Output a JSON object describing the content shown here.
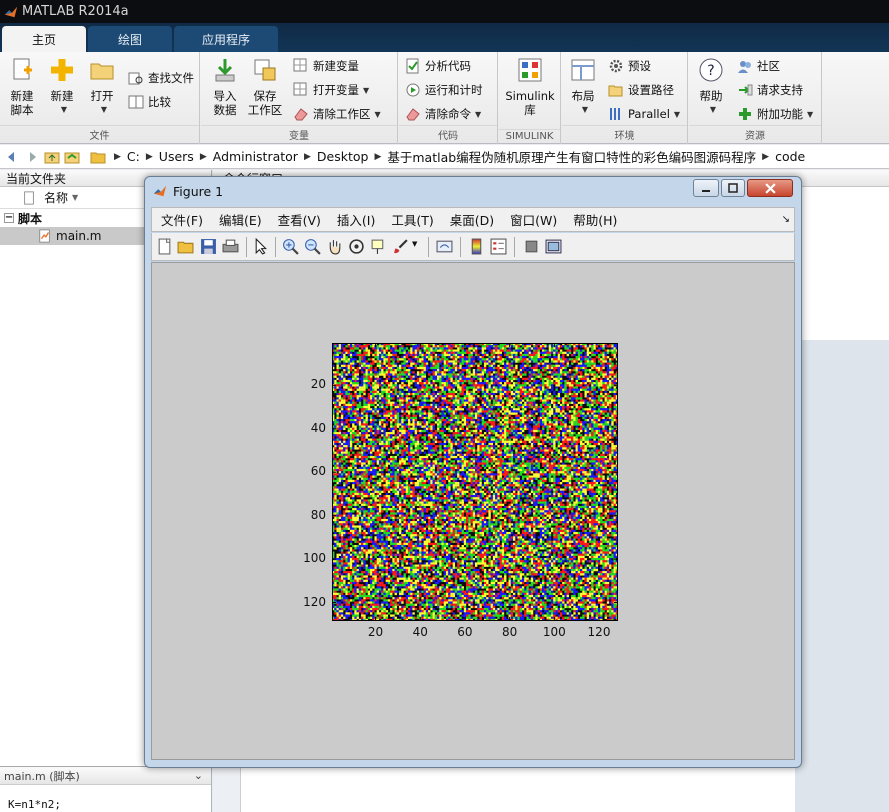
{
  "app": {
    "title": "MATLAB R2014a"
  },
  "tabs": [
    {
      "label": "主页",
      "active": true
    },
    {
      "label": "绘图",
      "active": false
    },
    {
      "label": "应用程序",
      "active": false
    }
  ],
  "ribbon": {
    "file": {
      "label": "文件",
      "new_script": "新建\n脚本",
      "new": "新建",
      "open": "打开",
      "find_files": "查找文件",
      "compare": "比较"
    },
    "variable": {
      "label": "变量",
      "import": "导入\n数据",
      "save_ws": "保存\n工作区",
      "new_var": "新建变量",
      "open_var": "打开变量",
      "clear_ws": "清除工作区"
    },
    "code": {
      "label": "代码",
      "analyze": "分析代码",
      "run_time": "运行和计时",
      "clear_cmd": "清除命令"
    },
    "simulink": {
      "label": "SIMULINK",
      "lib": "Simulink\n库"
    },
    "env": {
      "label": "环境",
      "layout": "布局",
      "prefs": "预设",
      "set_path": "设置路径",
      "parallel": "Parallel"
    },
    "resources": {
      "label": "资源",
      "help": "帮助",
      "community": "社区",
      "support": "请求支持",
      "addons": "附加功能"
    }
  },
  "address": {
    "crumbs": [
      "C:",
      "Users",
      "Administrator",
      "Desktop",
      "基于matlab编程伪随机原理产生有窗口特性的彩色编码图源码程序",
      "code"
    ]
  },
  "current_folder": {
    "title": "当前文件夹",
    "col_name": "名称",
    "group": "脚本",
    "file": "main.m",
    "detail_title": "main.m  (脚本)",
    "detail_code": "K=n1*n2;"
  },
  "command_window": {
    "title": "命令行窗口"
  },
  "figure": {
    "title": "Figure 1",
    "menu": [
      "文件(F)",
      "编辑(E)",
      "查看(V)",
      "插入(I)",
      "工具(T)",
      "桌面(D)",
      "窗口(W)",
      "帮助(H)"
    ],
    "axes": {
      "yticks": [
        "20",
        "40",
        "60",
        "80",
        "100",
        "120"
      ],
      "xticks": [
        "20",
        "40",
        "60",
        "80",
        "100",
        "120"
      ]
    }
  },
  "chart_data": {
    "type": "heatmap",
    "rows": 128,
    "cols": 128,
    "palette": [
      "#0b0b0b",
      "#ff1a1a",
      "#22dd22",
      "#1a1aff",
      "#ffff33"
    ],
    "xlim": [
      0.5,
      128.5
    ],
    "ylim": [
      0.5,
      128.5
    ],
    "xticks": [
      20,
      40,
      60,
      80,
      100,
      120
    ],
    "yticks": [
      20,
      40,
      60,
      80,
      100,
      120
    ]
  },
  "colors": {
    "accent": "#1d4a74",
    "titlebar": "#0c0d10",
    "canvas": "#cbcbcb"
  }
}
